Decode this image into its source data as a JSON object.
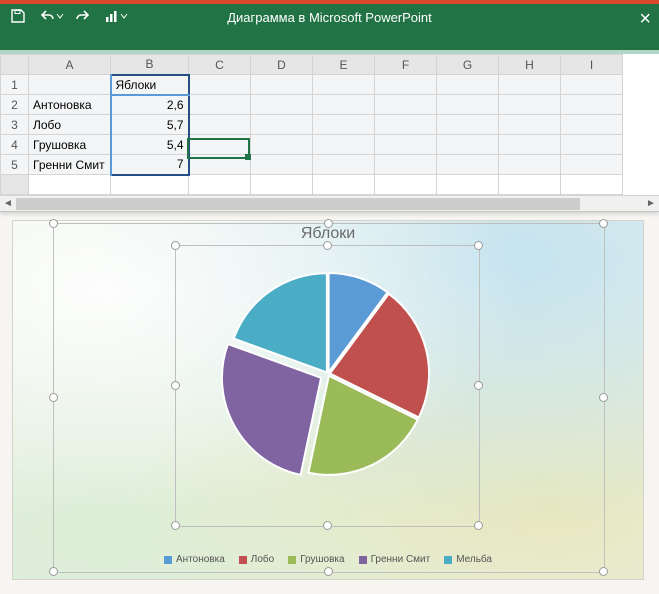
{
  "window": {
    "title": "Диаграмма в Microsoft PowerPoint"
  },
  "colors": {
    "series": [
      "#5b9bd5",
      "#c0504d",
      "#9bbb59",
      "#8064a2",
      "#4bacc6"
    ]
  },
  "sheet": {
    "columns": [
      "A",
      "B",
      "C",
      "D",
      "E",
      "F",
      "G",
      "H",
      "I"
    ],
    "header_label": "Яблоки",
    "rows": [
      {
        "n": "1",
        "a": "",
        "b": "Яблоки"
      },
      {
        "n": "2",
        "a": "Антоновка",
        "b": "2,6"
      },
      {
        "n": "3",
        "a": "Лобо",
        "b": "5,7"
      },
      {
        "n": "4",
        "a": "Грушовка",
        "b": "5,4"
      },
      {
        "n": "5",
        "a": "Гренни Смит",
        "b": "7"
      }
    ],
    "active_cell": "C4"
  },
  "chart_data": {
    "type": "pie",
    "title": "Яблоки",
    "series": [
      {
        "name": "Антоновка",
        "value": 2.6,
        "color": "#5b9bd5"
      },
      {
        "name": "Лобо",
        "value": 5.7,
        "color": "#c0504d"
      },
      {
        "name": "Грушовка",
        "value": 5.4,
        "color": "#9bbb59"
      },
      {
        "name": "Гренни Смит",
        "value": 7.0,
        "color": "#8064a2"
      },
      {
        "name": "Мельба",
        "value": 5.0,
        "color": "#4bacc6"
      }
    ],
    "legend_position": "bottom"
  }
}
